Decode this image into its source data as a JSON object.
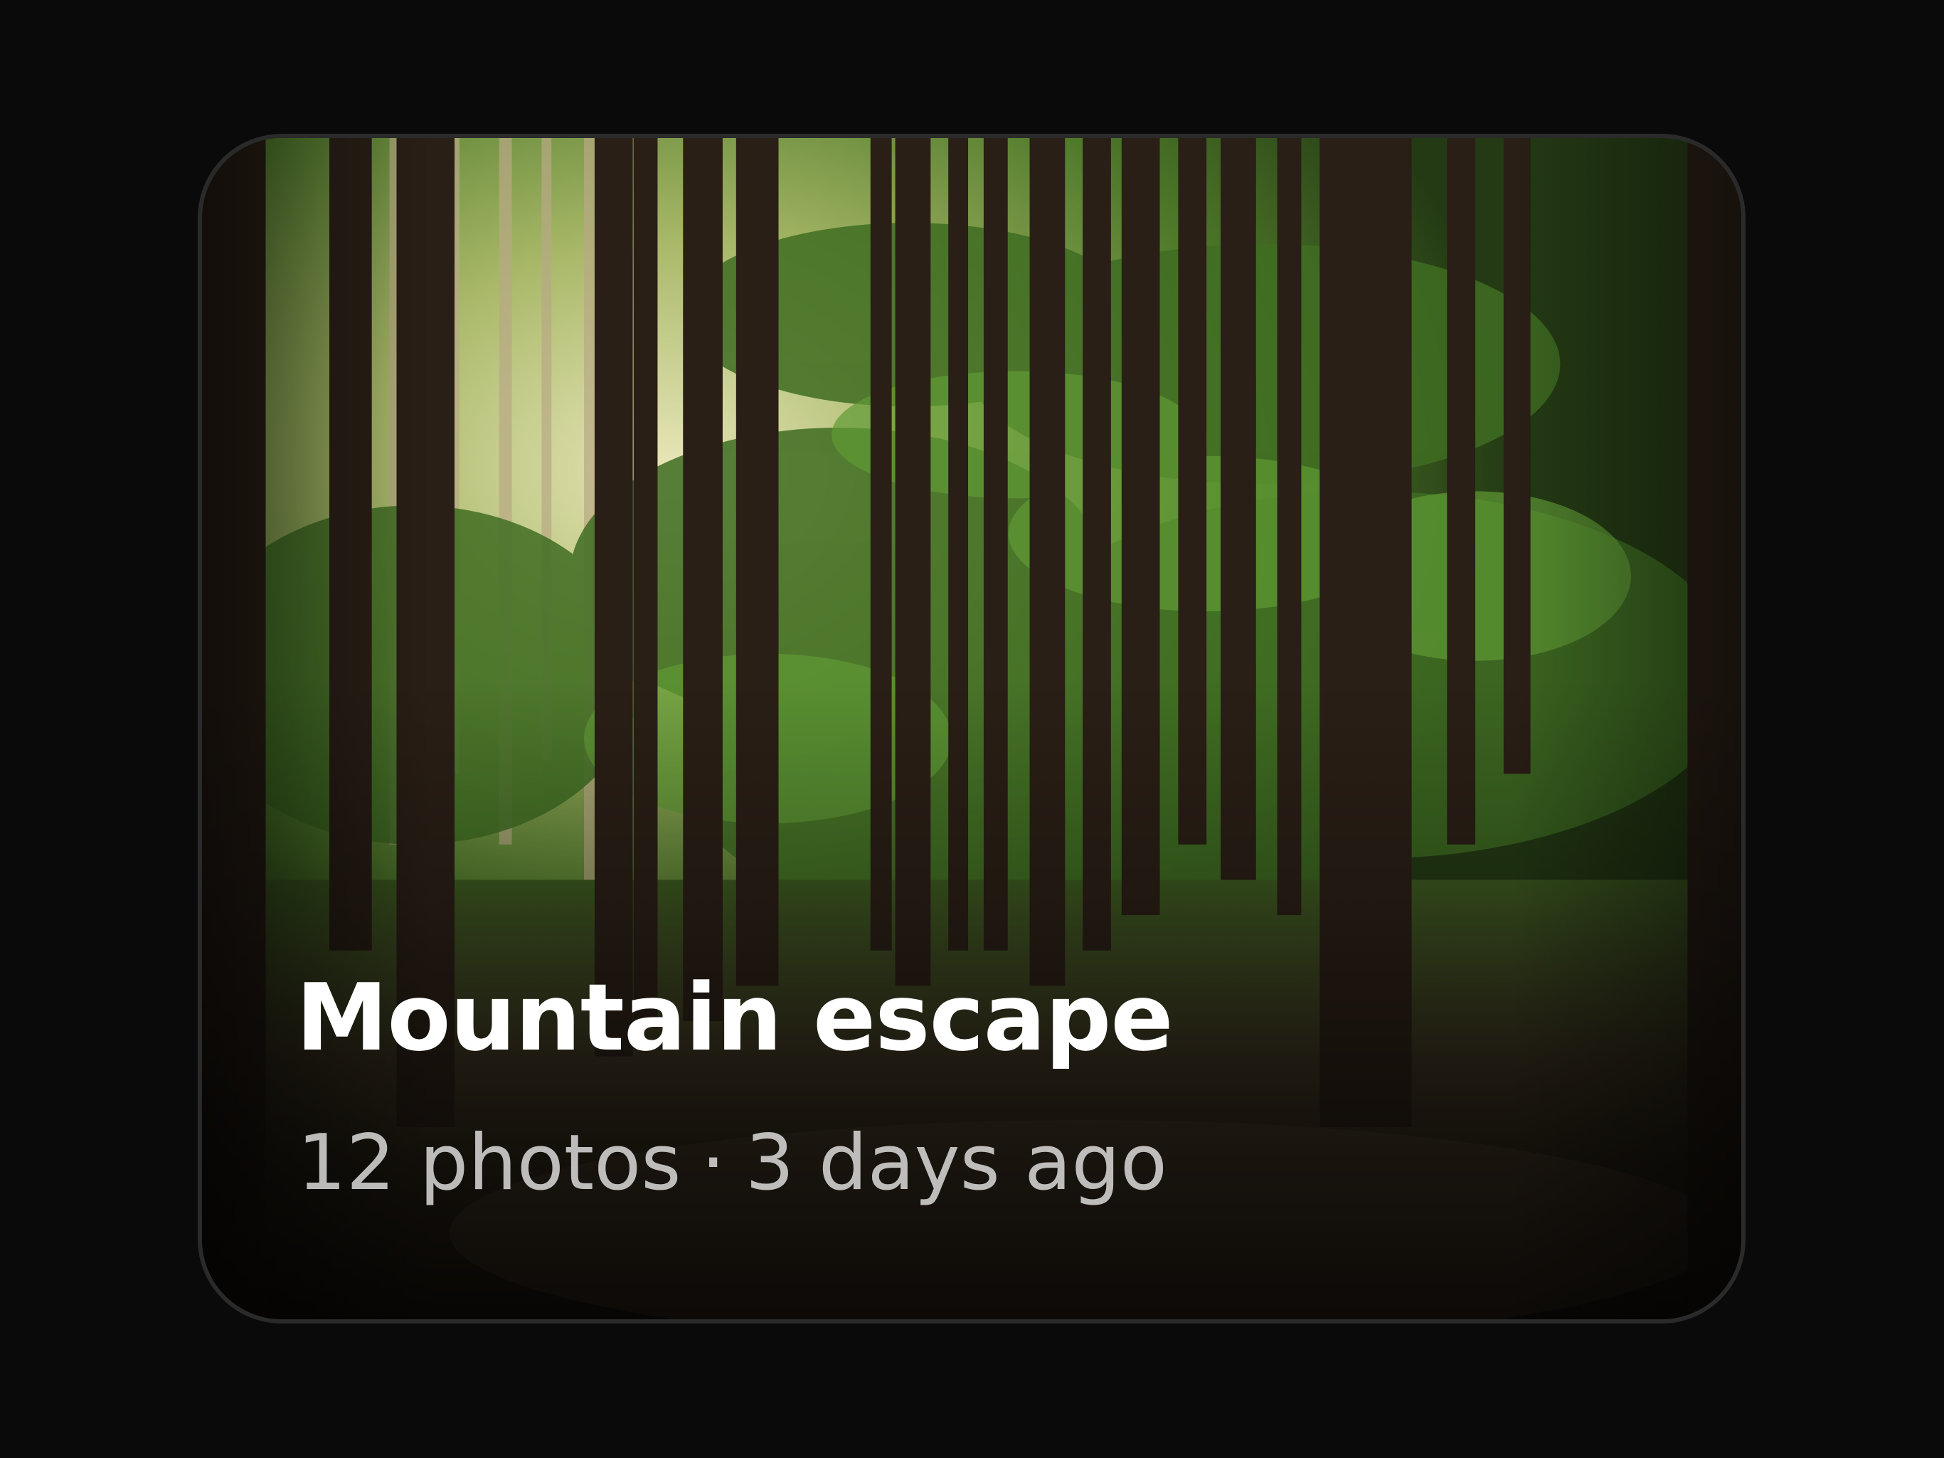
{
  "album": {
    "title": "Mountain escape",
    "photo_count": "12 photos",
    "separator": "·",
    "updated": "3 days ago",
    "image_subject": "forest-path-photo"
  }
}
